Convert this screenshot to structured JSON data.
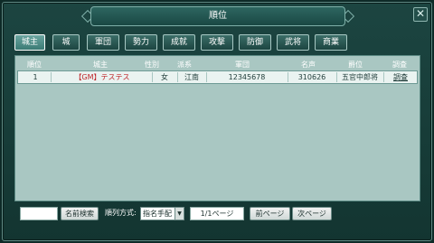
{
  "window": {
    "title": "順位",
    "close_glyph": "✕"
  },
  "tabs": [
    {
      "label": "城主",
      "active": true
    },
    {
      "label": "城"
    },
    {
      "label": "軍団"
    },
    {
      "label": "勢力"
    },
    {
      "label": "成就"
    },
    {
      "label": "攻撃"
    },
    {
      "label": "防御"
    },
    {
      "label": "武将"
    },
    {
      "label": "商業"
    }
  ],
  "table": {
    "headers": [
      "順位",
      "城主",
      "性別",
      "派系",
      "軍団",
      "名声",
      "爵位",
      "調査"
    ],
    "rows": [
      {
        "rank": "1",
        "lord_tag": "【GM】",
        "lord_name": "テステス",
        "gender": "女",
        "faction": "江南",
        "corps": "12345678",
        "fame": "310626",
        "title": "五官中郎将",
        "investigate": "調査"
      }
    ]
  },
  "controls": {
    "search_value": "",
    "search_button": "名前検索",
    "sort_label": "順列方式:",
    "sort_selected": "指名手配",
    "page_indicator": "1/1ページ",
    "prev_button": "前ページ",
    "next_button": "次ページ"
  },
  "colors": {
    "frame_bg": "#1c4541",
    "panel_bg": "#a9c7c2",
    "row_bg": "#eaf3f1",
    "gm_red": "#c0262a"
  }
}
